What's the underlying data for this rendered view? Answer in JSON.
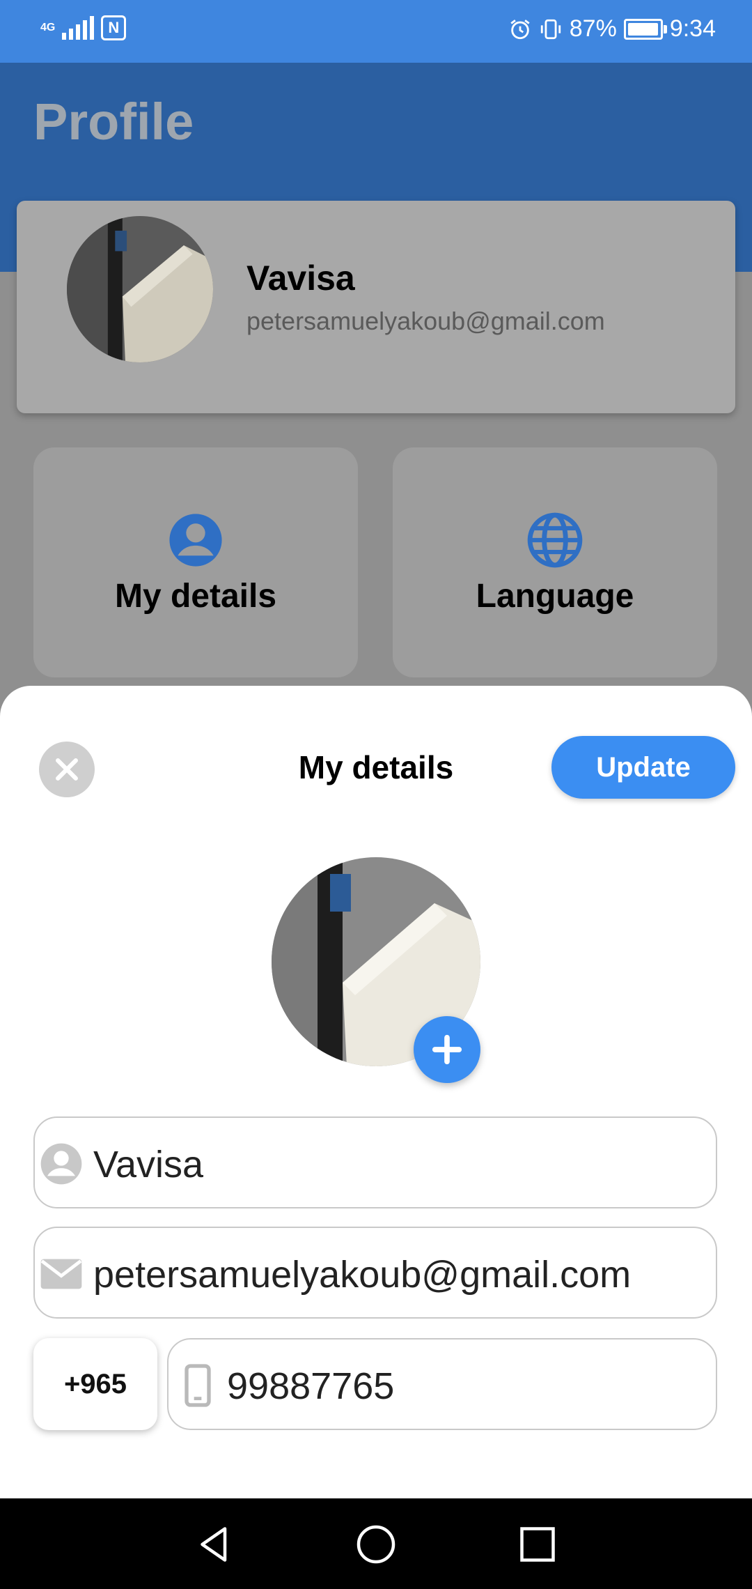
{
  "status_bar": {
    "network": "4G",
    "battery_percent": "87%",
    "battery_level": 0.87,
    "time": "9:34"
  },
  "background_screen": {
    "title": "Profile",
    "profile": {
      "name": "Vavisa",
      "email": "petersamuelyakoub@gmail.com"
    },
    "tiles": [
      {
        "label": "My details",
        "icon": "account-circle-icon"
      },
      {
        "label": "Language",
        "icon": "globe-icon"
      }
    ]
  },
  "sheet": {
    "title": "My details",
    "update_label": "Update",
    "fields": {
      "name": "Vavisa",
      "email": "petersamuelyakoub@gmail.com",
      "country_code": "+965",
      "phone": "99887765"
    }
  },
  "colors": {
    "status_bar": "#3f86df",
    "app_bar": "#2b5fa1",
    "accent": "#3b8ef2",
    "icon_blue": "#2f6fc4"
  }
}
